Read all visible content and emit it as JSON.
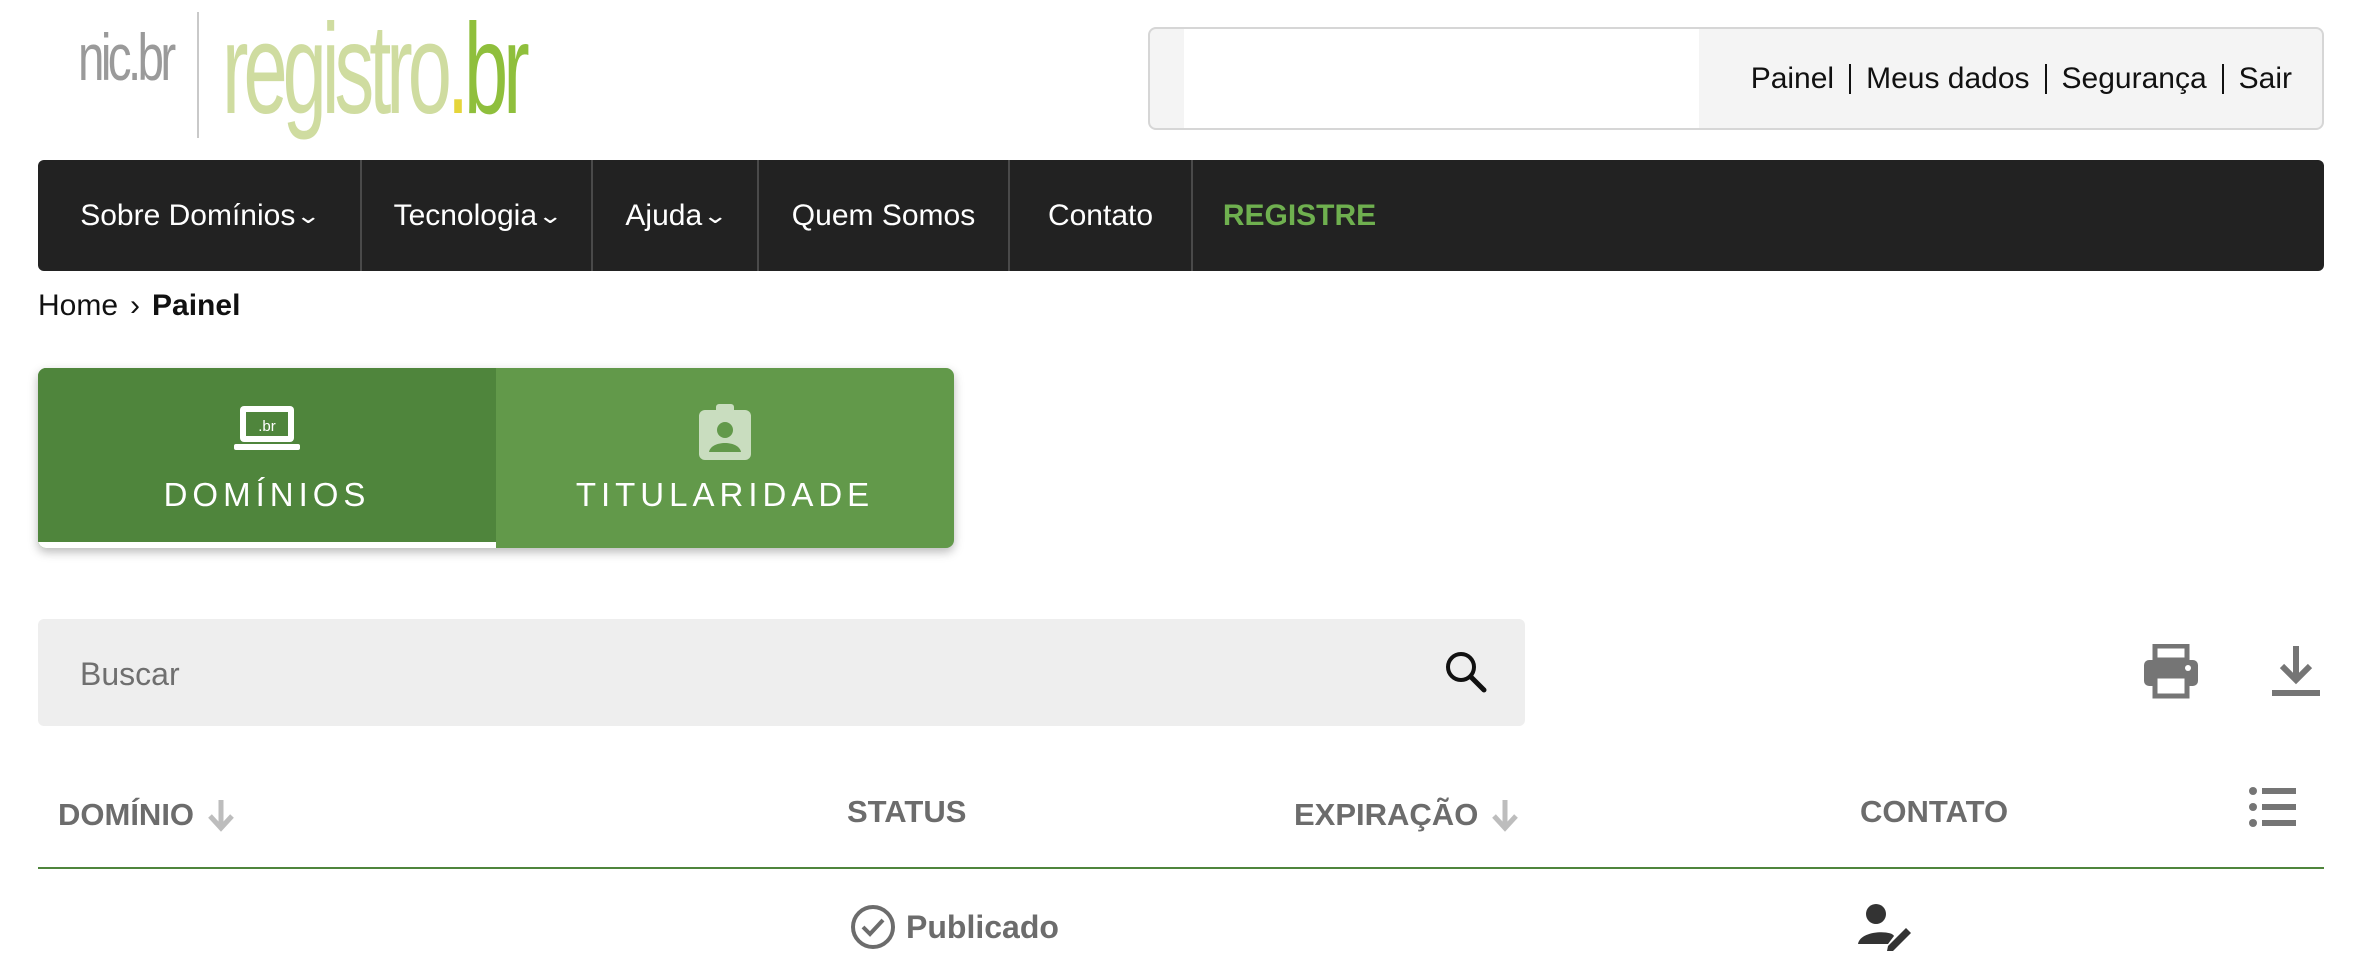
{
  "logo": {
    "nic": "nic.br",
    "registro": "registro",
    "dot": ".",
    "br": "br"
  },
  "user_menu": {
    "links": [
      "Painel",
      "Meus dados",
      "Segurança",
      "Sair"
    ]
  },
  "nav": {
    "items": [
      {
        "label": "Sobre Domínios",
        "dropdown": true
      },
      {
        "label": "Tecnologia",
        "dropdown": true
      },
      {
        "label": "Ajuda",
        "dropdown": true
      },
      {
        "label": "Quem Somos",
        "dropdown": false
      },
      {
        "label": "Contato",
        "dropdown": false
      },
      {
        "label": "REGISTRE",
        "dropdown": false
      }
    ],
    "chevron": "⌄"
  },
  "breadcrumb": {
    "home": "Home",
    "separator": "›",
    "current": "Painel"
  },
  "tabs": [
    {
      "label": "DOMÍNIOS",
      "icon": "laptop-icon",
      "active": true
    },
    {
      "label": "TITULARIDADE",
      "icon": "badge-icon",
      "active": false
    }
  ],
  "search": {
    "placeholder": "Buscar",
    "value": ""
  },
  "table": {
    "headers": {
      "domain": "DOMÍNIO",
      "status": "STATUS",
      "expiration": "EXPIRAÇÃO",
      "contact": "CONTATO"
    },
    "rows": [
      {
        "domain": "",
        "status": "Publicado",
        "expiration": "",
        "contact_icon": "edit-contact-icon"
      }
    ]
  },
  "colors": {
    "nav_bg": "#222222",
    "registre": "#6fb04f",
    "tab_bg": "#62994a",
    "tab_active": "#4f853c"
  }
}
